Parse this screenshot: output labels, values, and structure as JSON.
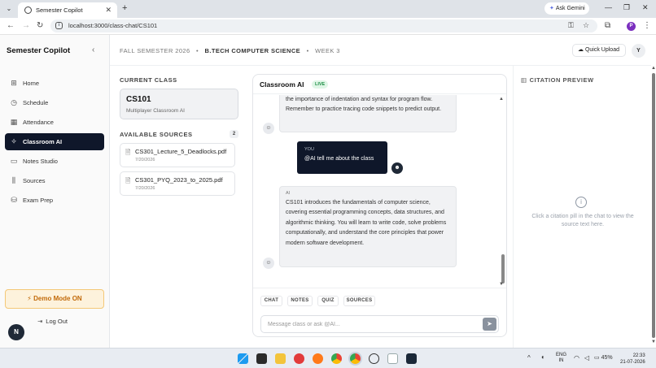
{
  "browser": {
    "tab_title": "Semester Copilot",
    "gemini_label": "Ask Gemini",
    "url": "localhost:3000/class-chat/CS101",
    "profile_initial": "P"
  },
  "sidebar": {
    "brand": "Semester Copilot",
    "items": [
      {
        "label": "Home",
        "icon": "home-icon"
      },
      {
        "label": "Schedule",
        "icon": "clock-icon"
      },
      {
        "label": "Attendance",
        "icon": "calendar-icon"
      },
      {
        "label": "Classroom AI",
        "icon": "spark-icon",
        "active": true
      },
      {
        "label": "Notes Studio",
        "icon": "notes-icon"
      },
      {
        "label": "Sources",
        "icon": "library-icon"
      },
      {
        "label": "Exam Prep",
        "icon": "database-icon"
      }
    ],
    "demo_label": "Demo Mode ON",
    "avatar_initial": "N",
    "logout_label": "Log Out"
  },
  "header": {
    "crumbs": [
      "FALL SEMESTER 2026",
      "•",
      "B.TECH COMPUTER SCIENCE",
      "•",
      "WEEK 3"
    ],
    "quick_upload": "Quick Upload",
    "user_initial": "Y"
  },
  "left_panel": {
    "current_class_label": "CURRENT CLASS",
    "class_code": "CS101",
    "class_sub": "Multiplayer Classroom AI",
    "sources_label": "AVAILABLE SOURCES",
    "sources_count": "2",
    "sources": [
      {
        "name": "CS301_Lecture_5_Deadlocks.pdf",
        "date": "7/20/2026"
      },
      {
        "name": "CS301_PYQ_2023_to_2025.pdf",
        "date": "7/20/2026"
      }
    ]
  },
  "chat": {
    "title": "Classroom AI",
    "live_badge": "LIVE",
    "messages": [
      {
        "role": "",
        "text": "the importance of indentation and syntax for program flow. Remember to practice tracing code snippets to predict output."
      },
      {
        "role": "YOU",
        "text": "@AI tell me about the class"
      },
      {
        "role": "AI",
        "text": "CS101 introduces the fundamentals of computer science, covering essential programming concepts, data structures, and algorithmic thinking. You will learn to write code, solve problems computationally, and understand the core principles that power modern software development."
      }
    ],
    "modes": [
      "CHAT",
      "NOTES",
      "QUIZ",
      "SOURCES"
    ],
    "input_placeholder": "Message class or ask @AI...",
    "input_value": ""
  },
  "citation": {
    "title": "CITATION PREVIEW",
    "empty_text": "Click a citation pill in the chat to view the source text here."
  },
  "taskbar": {
    "lang_top": "ENG",
    "lang_bottom": "IN",
    "battery": "45%",
    "time": "22:33",
    "date": "21-07-2026"
  },
  "colors": {
    "active_nav": "#0f172a",
    "live_green": "#1e8e46",
    "demo_orange": "#c26a0a",
    "demo_bg": "#fdf2dc"
  }
}
